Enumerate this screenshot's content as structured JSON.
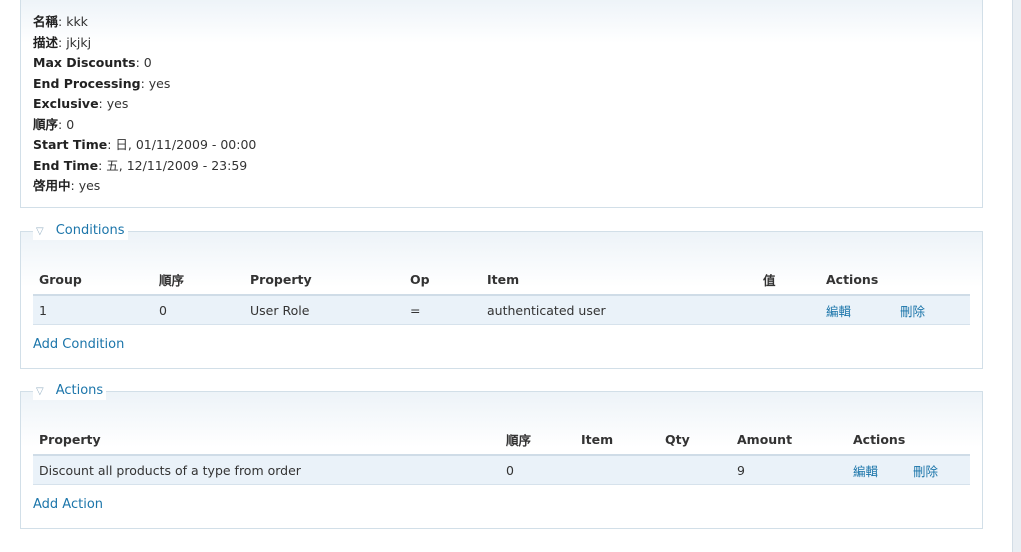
{
  "info": [
    {
      "label": "名稱",
      "value": "kkk"
    },
    {
      "label": "描述",
      "value": "jkjkj"
    },
    {
      "label": "Max Discounts",
      "value": "0"
    },
    {
      "label": "End Processing",
      "value": "yes"
    },
    {
      "label": "Exclusive",
      "value": "yes"
    },
    {
      "label": "順序",
      "value": "0"
    },
    {
      "label": "Start Time",
      "value": "日, 01/11/2009 - 00:00"
    },
    {
      "label": "End Time",
      "value": "五, 12/11/2009 - 23:59"
    },
    {
      "label": "啓用中",
      "value": "yes"
    }
  ],
  "conditions": {
    "legend": "Conditions",
    "toggle_icon": "triangle-down",
    "headers": [
      "Group",
      "順序",
      "Property",
      "Op",
      "Item",
      "值",
      "Actions"
    ],
    "rows": [
      {
        "group": "1",
        "order": "0",
        "property": "User Role",
        "op": "=",
        "item": "authenticated user",
        "value": "",
        "edit": "編輯",
        "delete": "刪除"
      }
    ],
    "add_label": "Add Condition"
  },
  "actions": {
    "legend": "Actions",
    "toggle_icon": "triangle-down",
    "headers": [
      "Property",
      "順序",
      "Item",
      "Qty",
      "Amount",
      "Actions"
    ],
    "rows": [
      {
        "property": "Discount all products of a type from order",
        "order": "0",
        "item": "",
        "qty": "",
        "amount": "9",
        "edit": "編輯",
        "delete": "刪除"
      }
    ],
    "add_label": "Add Action"
  },
  "colors": {
    "link": "#1b75aa",
    "border": "#d2dfe8",
    "row_bg": "#eaf2f9"
  }
}
